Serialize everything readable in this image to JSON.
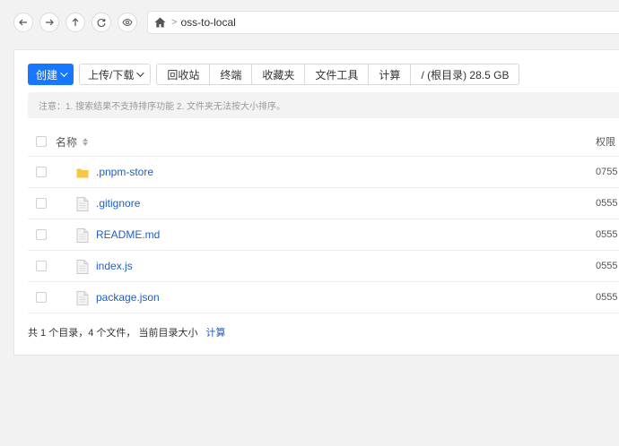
{
  "address_bar": {
    "path": "oss-to-local",
    "separator": ">"
  },
  "toolbar": {
    "create_label": "创建",
    "upload_download_label": "上传/下载",
    "group": [
      "回收站",
      "终端",
      "收藏夹",
      "文件工具",
      "计算",
      "/ (根目录) 28.5 GB"
    ]
  },
  "notice": "注意：1. 搜索结果不支持排序功能 2. 文件夹无法按大小排序。",
  "table": {
    "col_name": "名称",
    "col_perm": "权限",
    "rows": [
      {
        "name": ".pnpm-store",
        "type": "folder",
        "perm": "0755"
      },
      {
        "name": ".gitignore",
        "type": "file",
        "perm": "0555"
      },
      {
        "name": "README.md",
        "type": "file",
        "perm": "0555"
      },
      {
        "name": "index.js",
        "type": "file",
        "perm": "0555"
      },
      {
        "name": "package.json",
        "type": "file",
        "perm": "0555"
      }
    ]
  },
  "summary": {
    "text": "共 1 个目录，4 个文件， 当前目录大小",
    "link": "计算"
  },
  "colors": {
    "primary": "#1677ff",
    "link": "#1f5fbf",
    "folder": "#f7c742"
  }
}
